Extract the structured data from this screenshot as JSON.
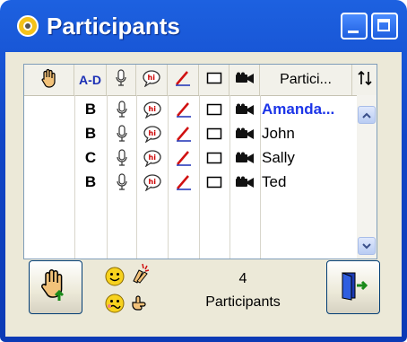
{
  "window": {
    "title": "Participants"
  },
  "columns": [
    {
      "id": "hand",
      "label": "",
      "icon": "raise-hand-icon"
    },
    {
      "id": "grade",
      "label": "A-D"
    },
    {
      "id": "mic",
      "label": "",
      "icon": "microphone-icon"
    },
    {
      "id": "chat",
      "label": "",
      "icon": "chat-bubble-icon"
    },
    {
      "id": "draw",
      "label": "",
      "icon": "pencil-icon"
    },
    {
      "id": "whiteboard",
      "label": "",
      "icon": "whiteboard-icon"
    },
    {
      "id": "video",
      "label": "",
      "icon": "video-camera-icon"
    },
    {
      "id": "name",
      "label": "Partici..."
    },
    {
      "id": "sort",
      "label": "",
      "icon": "sort-arrows-icon"
    }
  ],
  "participants": [
    {
      "grade": "B",
      "name": "Amanda...",
      "selected": true
    },
    {
      "grade": "B",
      "name": "John",
      "selected": false
    },
    {
      "grade": "C",
      "name": "Sally",
      "selected": false
    },
    {
      "grade": "B",
      "name": "Ted",
      "selected": false
    }
  ],
  "footer": {
    "count": "4",
    "count_label": "Participants",
    "raise_hand_icon": "raise-hand-up-icon",
    "exit_icon": "exit-door-icon",
    "emotes": [
      "smiley-icon",
      "clap-icon",
      "confused-icon",
      "hand-point-icon"
    ]
  },
  "colors": {
    "titlebar": "#1146c7",
    "selected_name": "#1c35e8",
    "client_bg": "#ece9d8"
  }
}
